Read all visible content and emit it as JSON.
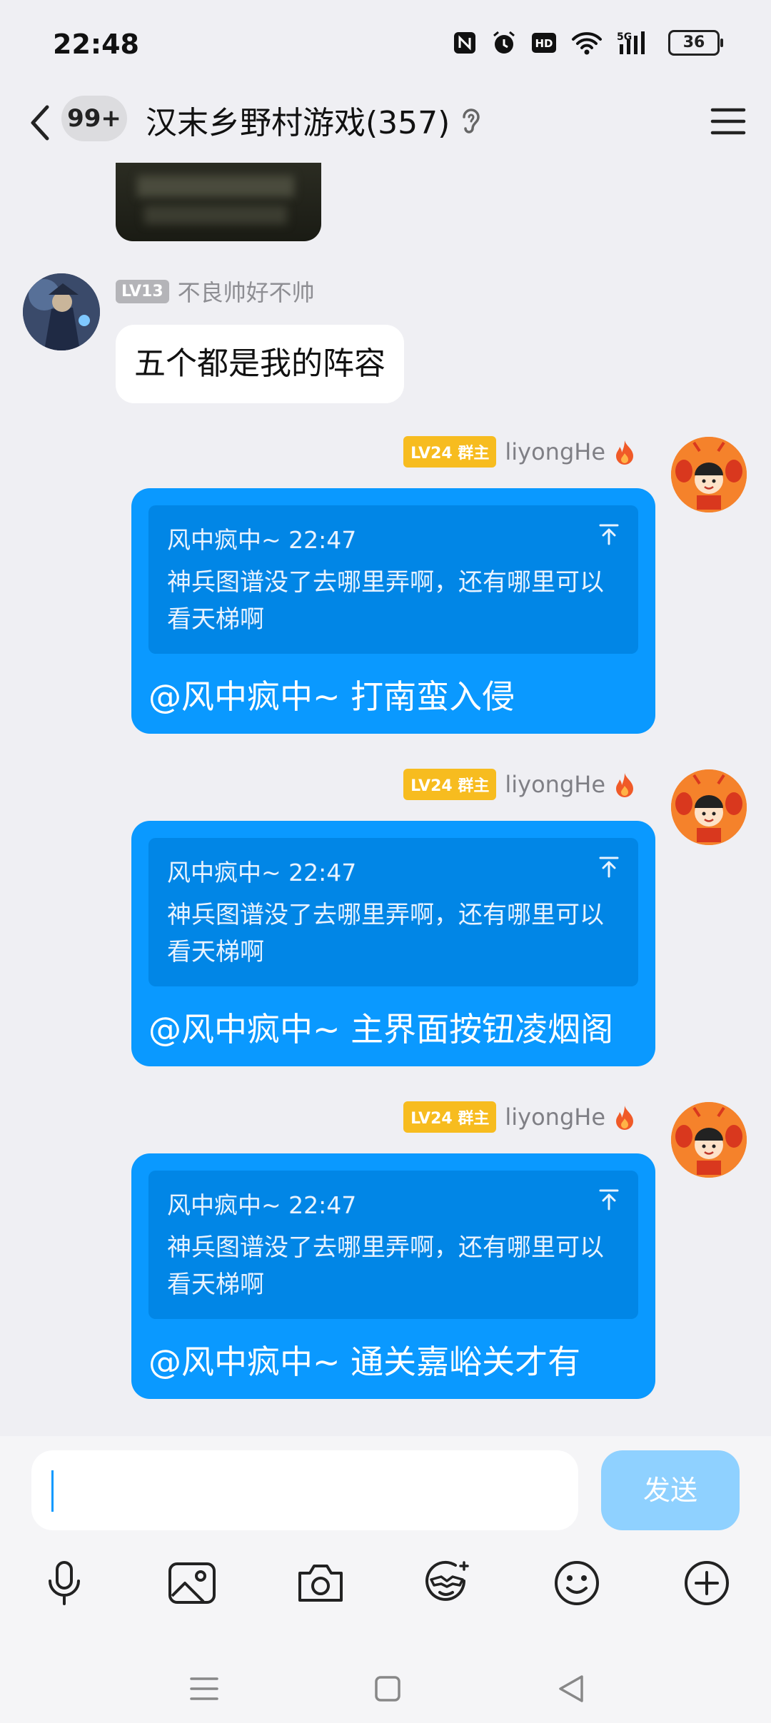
{
  "status_bar": {
    "time": "22:48",
    "network": "5G",
    "battery": "36"
  },
  "header": {
    "unread_count": "99+",
    "title": "汉末乡野村游戏(357)"
  },
  "messages": {
    "incoming": {
      "level": "LV13",
      "sender": "不良帅好不帅",
      "text": "五个都是我的阵容"
    },
    "outgoing": [
      {
        "level": "LV24 群主",
        "sender": "liyongHe",
        "quote_meta": "风中疯中~ 22:47",
        "quote_text": "神兵图谱没了去哪里弄啊，还有哪里可以看天梯啊",
        "reply": "@风中疯中~ 打南蛮入侵"
      },
      {
        "level": "LV24 群主",
        "sender": "liyongHe",
        "quote_meta": "风中疯中~ 22:47",
        "quote_text": "神兵图谱没了去哪里弄啊，还有哪里可以看天梯啊",
        "reply": "@风中疯中~ 主界面按钮凌烟阁"
      },
      {
        "level": "LV24 群主",
        "sender": "liyongHe",
        "quote_meta": "风中疯中~ 22:47",
        "quote_text": "神兵图谱没了去哪里弄啊，还有哪里可以看天梯啊",
        "reply": "@风中疯中~ 通关嘉峪关才有"
      }
    ]
  },
  "composer": {
    "input_value": "",
    "send_label": "发送"
  },
  "toolbar_icons": [
    "microphone-icon",
    "image-icon",
    "camera-icon",
    "sticker-icon",
    "emoji-icon",
    "plus-icon"
  ],
  "colors": {
    "bubble_out": "#0a99ff",
    "quote_bg": "#0186e6",
    "level_gold": "#f7bc1f",
    "send_disabled": "#8fd1ff"
  }
}
